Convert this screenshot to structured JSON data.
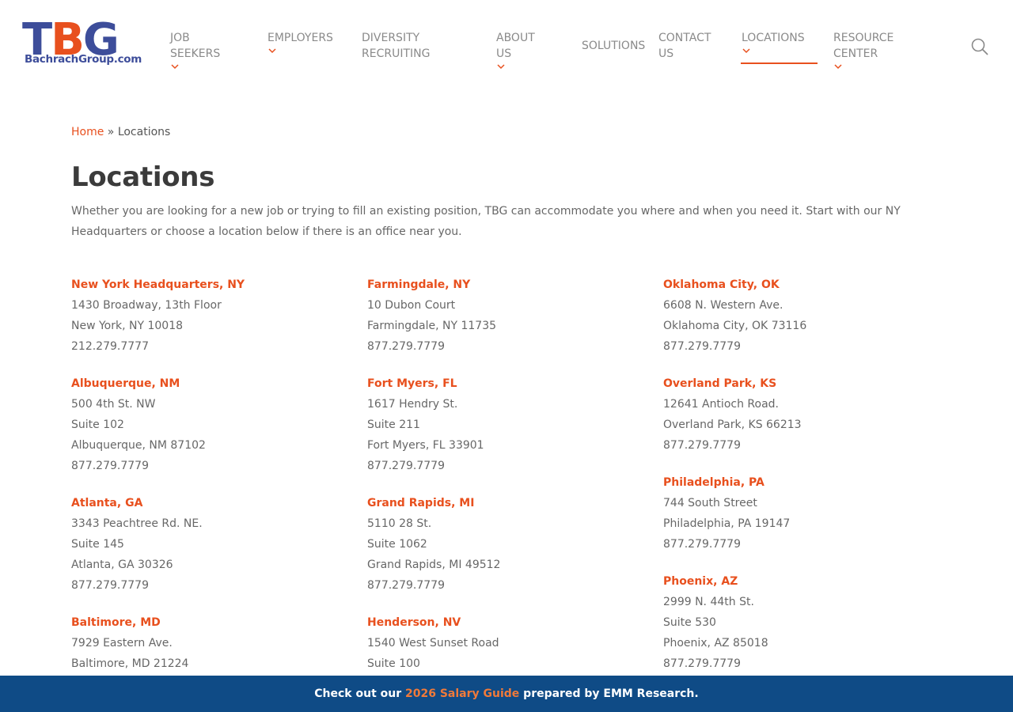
{
  "logo": {
    "letters": "TBG",
    "url_text": "BachrachGroup.com"
  },
  "colors": {
    "accent": "#e8501e",
    "brand_blue": "#3d4d9a",
    "banner_bg": "#0f4b86"
  },
  "nav": [
    {
      "label": "JOB SEEKERS",
      "has_dropdown": true
    },
    {
      "label": "EMPLOYERS",
      "has_dropdown": true
    },
    {
      "label": "DIVERSITY RECRUITING",
      "has_dropdown": false
    },
    {
      "label": "ABOUT US",
      "has_dropdown": true
    },
    {
      "label": "SOLUTIONS",
      "has_dropdown": false
    },
    {
      "label": "CONTACT US",
      "has_dropdown": false
    },
    {
      "label": "LOCATIONS",
      "has_dropdown": true,
      "active": true
    },
    {
      "label": "RESOURCE CENTER",
      "has_dropdown": true
    }
  ],
  "search_icon": "search-icon",
  "breadcrumb": {
    "home": "Home",
    "separator": " » ",
    "current": "Locations"
  },
  "title": "Locations",
  "intro": "Whether you are looking for a new job or trying to fill an existing position, TBG can accommodate you where and when you need it. Start with our NY Headquarters or choose a location below if there is an office near you.",
  "columns": [
    [
      {
        "name": "New York Headquarters, NY",
        "lines": [
          "1430 Broadway, 13th Floor",
          "New York, NY 10018",
          "212.279.7777"
        ]
      },
      {
        "name": "Albuquerque, NM",
        "lines": [
          "500 4th St. NW",
          "Suite 102",
          "Albuquerque, NM 87102",
          "877.279.7779"
        ]
      },
      {
        "name": "Atlanta, GA",
        "lines": [
          "3343 Peachtree Rd. NE.",
          "Suite 145",
          "Atlanta, GA 30326",
          "877.279.7779"
        ]
      },
      {
        "name": "Baltimore, MD",
        "lines": [
          "7929 Eastern Ave.",
          "Baltimore, MD 21224"
        ]
      }
    ],
    [
      {
        "name": "Farmingdale, NY",
        "lines": [
          "10 Dubon Court",
          "Farmingdale, NY 11735",
          "877.279.7779"
        ]
      },
      {
        "name": "Fort Myers, FL",
        "lines": [
          "1617 Hendry St.",
          "Suite 211",
          "Fort Myers, FL 33901",
          "877.279.7779"
        ]
      },
      {
        "name": "Grand Rapids, MI",
        "lines": [
          "5110 28 St.",
          "Suite 1062",
          "Grand Rapids, MI 49512",
          "877.279.7779"
        ]
      },
      {
        "name": "Henderson, NV",
        "lines": [
          "1540 West Sunset Road",
          "Suite 100"
        ]
      }
    ],
    [
      {
        "name": "Oklahoma City, OK",
        "lines": [
          "6608 N. Western Ave.",
          "Oklahoma City, OK 73116",
          "877.279.7779"
        ]
      },
      {
        "name": "Overland Park, KS",
        "lines": [
          "12641 Antioch Road.",
          "Overland Park, KS 66213",
          "877.279.7779"
        ]
      },
      {
        "name": "Philadelphia, PA",
        "lines": [
          "744 South Street",
          "Philadelphia, PA 19147",
          "877.279.7779"
        ]
      },
      {
        "name": "Phoenix, AZ",
        "lines": [
          "2999 N. 44th St.",
          "Suite 530",
          "Phoenix, AZ 85018",
          "877.279.7779"
        ]
      }
    ]
  ],
  "banner": {
    "prefix": "Check out our ",
    "link": "2026 Salary Guide",
    "suffix": " prepared by EMM Research."
  }
}
